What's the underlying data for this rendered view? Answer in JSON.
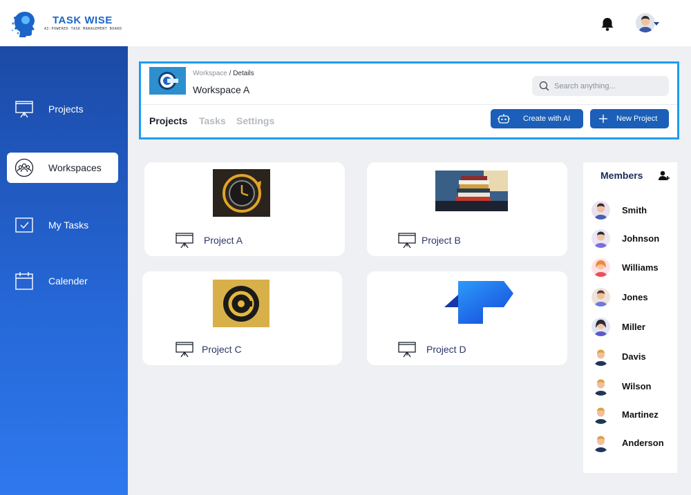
{
  "app": {
    "name": "TASK WISE",
    "tagline": "AI-POWERED TASK MANAGEMENT BOARD"
  },
  "sidebar": {
    "items": [
      {
        "label": "Projects",
        "icon": "presentation-board-icon",
        "active": false
      },
      {
        "label": "Workspaces",
        "icon": "group-icon",
        "active": true
      },
      {
        "label": "My Tasks",
        "icon": "checkbox-icon",
        "active": false
      },
      {
        "label": "Calender",
        "icon": "calendar-icon",
        "active": false
      }
    ]
  },
  "workspace": {
    "breadcrumb": {
      "parent": "Workspace",
      "separator": " / ",
      "current": "Details"
    },
    "title": "Workspace A",
    "search_placeholder": "Search anything...",
    "tabs": [
      {
        "label": "Projects",
        "active": true
      },
      {
        "label": "Tasks",
        "active": false
      },
      {
        "label": "Settings",
        "active": false
      }
    ],
    "buttons": {
      "create_ai": "Create with AI",
      "new_project": "New Project"
    }
  },
  "projects": [
    {
      "name": "Project A",
      "image": "clock-emblem-image"
    },
    {
      "name": "Project B",
      "image": "book-stack-image"
    },
    {
      "name": "Project C",
      "image": "gold-logo-image"
    },
    {
      "name": "Project D",
      "image": "blue-ribbon-logo-image"
    }
  ],
  "members": {
    "title": "Members",
    "list": [
      {
        "name": "Smith"
      },
      {
        "name": "Johnson"
      },
      {
        "name": "Williams"
      },
      {
        "name": "Jones"
      },
      {
        "name": "Miller"
      },
      {
        "name": "Davis"
      },
      {
        "name": "Wilson"
      },
      {
        "name": "Martinez"
      },
      {
        "name": "Anderson"
      }
    ]
  },
  "colors": {
    "brand": "#1b64c8",
    "sidebar_top": "#1b4aa6",
    "sidebar_bottom": "#2e79ee",
    "button": "#1b5fb8",
    "highlight_border": "#1f9cf0"
  }
}
